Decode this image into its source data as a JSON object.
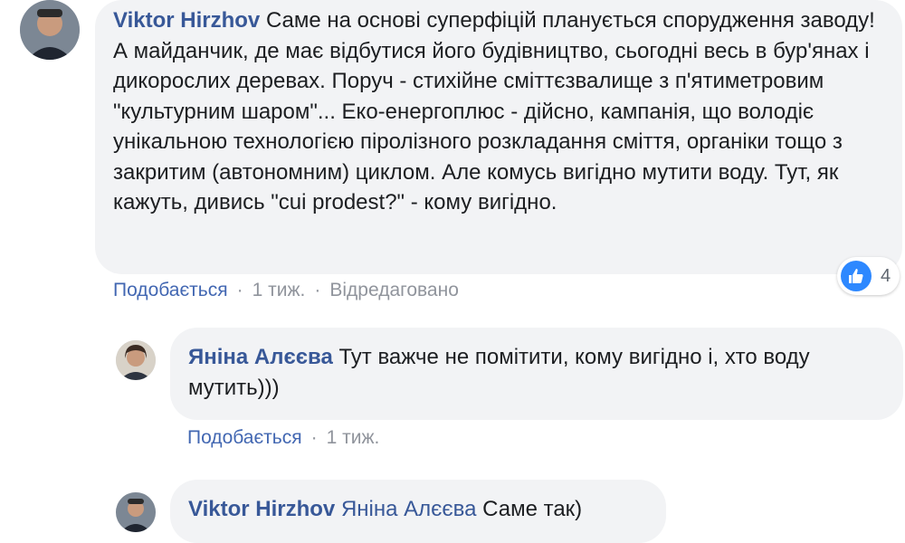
{
  "comments": [
    {
      "author": "Viktor Hirzhov",
      "text": "Саме на основі суперфіцій планується спорудження заводу! А майданчик, де має відбутися його будівництво, сьогодні весь в бур'янах і дикорослих деревах. Поруч - стихійне сміттєзвалище з п'ятиметровим \"культурним шаром\"... Еко-енергоплюс - дійсно, кампанія, що володіє унікальною технологією піролізного розкладання сміття, органіки тощо з закритим (автономним) циклом. Але комусь вигідно мутити воду. Тут, як кажуть, дивись \"cui prodest?\" - кому вигідно.",
      "like_label": "Подобається",
      "time": "1 тиж.",
      "edited": "Відредаговано",
      "reaction_count": "4"
    }
  ],
  "replies": [
    {
      "author": "Яніна Алєєва",
      "text": "Тут важче не помітити, кому вигідно і, хто воду мутить)))",
      "like_label": "Подобається",
      "time": "1 тиж."
    },
    {
      "author": "Viktor Hirzhov",
      "mention": "Яніна Алєєва",
      "text": "Саме так)"
    }
  ],
  "icons": {
    "reaction": "like-icon"
  },
  "colors": {
    "author_link": "#385898",
    "bubble_bg": "#f2f3f5",
    "action_link": "#4267b2",
    "meta_gray": "#90949c",
    "like_blue": "#2d88ff"
  }
}
